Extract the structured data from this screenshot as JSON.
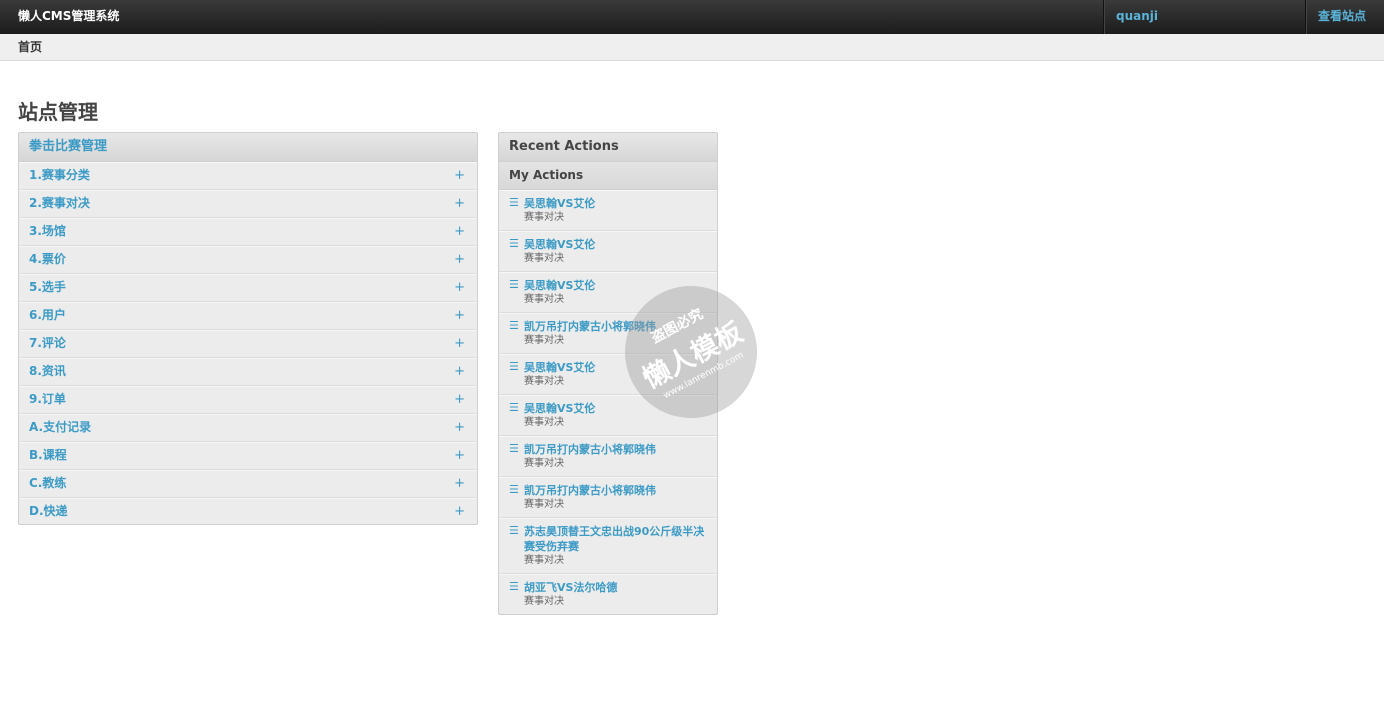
{
  "header": {
    "brand": "懒人CMS管理系统",
    "user": "quanji",
    "view_site": "查看站点"
  },
  "breadcrumb": {
    "home": "首页"
  },
  "page_title": "站点管理",
  "app_module": {
    "title": "拳击比赛管理",
    "add_symbol": "+",
    "models": [
      "1.赛事分类",
      "2.赛事对决",
      "3.场馆",
      "4.票价",
      "5.选手",
      "6.用户",
      "7.评论",
      "8.资讯",
      "9.订单",
      "A.支付记录",
      "B.课程",
      "C.教练",
      "D.快递"
    ]
  },
  "recent_actions": {
    "title": "Recent Actions",
    "subtitle": "My Actions",
    "glyph": "☰",
    "items": [
      {
        "title": "吴思翰VS艾伦",
        "type": "赛事对决"
      },
      {
        "title": "吴思翰VS艾伦",
        "type": "赛事对决"
      },
      {
        "title": "吴思翰VS艾伦",
        "type": "赛事对决"
      },
      {
        "title": "凯万吊打内蒙古小将郭晓伟",
        "type": "赛事对决"
      },
      {
        "title": "吴思翰VS艾伦",
        "type": "赛事对决"
      },
      {
        "title": "吴思翰VS艾伦",
        "type": "赛事对决"
      },
      {
        "title": "凯万吊打内蒙古小将郭晓伟",
        "type": "赛事对决"
      },
      {
        "title": "凯万吊打内蒙古小将郭晓伟",
        "type": "赛事对决"
      },
      {
        "title": "苏志昊顶替王文忠出战90公斤级半决赛受伤弃赛",
        "type": "赛事对决"
      },
      {
        "title": "胡亚飞VS法尔哈德",
        "type": "赛事对决"
      }
    ]
  },
  "watermark": {
    "top": "盗图必究",
    "main": "懒人模板",
    "url": "www.lanrenmb.com"
  },
  "colors": {
    "link": "#3c9bc6",
    "header_bg": "#2a2a2a",
    "header_link": "#5ab3d9",
    "module_bg": "#ececec"
  }
}
